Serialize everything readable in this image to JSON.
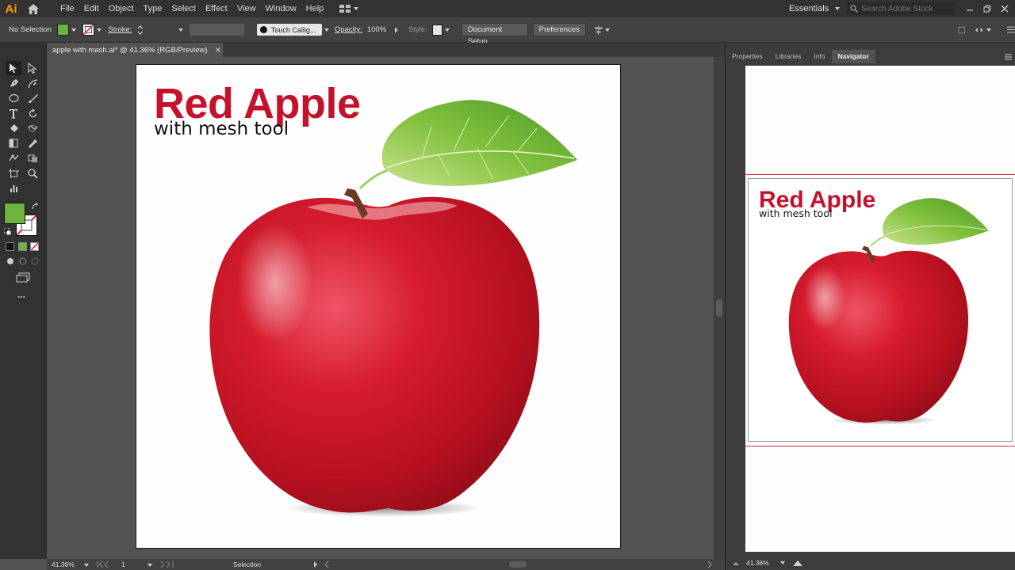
{
  "app": {
    "logo": "Ai"
  },
  "menu": [
    "File",
    "Edit",
    "Object",
    "Type",
    "Select",
    "Effect",
    "View",
    "Window",
    "Help"
  ],
  "workspace": {
    "label": "Essentials"
  },
  "search": {
    "placeholder": "Search Adobe Stock"
  },
  "control_bar": {
    "selection": "No Selection",
    "fill_color": "#6cb33f",
    "stroke_label": "Stroke:",
    "brush": "Touch Callig...",
    "opacity_label": "Opacity:",
    "opacity_value": "100%",
    "style_label": "Style:",
    "document_setup": "Document Setup",
    "preferences": "Preferences"
  },
  "document": {
    "tab_title": "apple with mash.ai* @ 41.36% (RGB/Preview)",
    "close": "×"
  },
  "artwork": {
    "title": "Red Apple",
    "subtitle": "with mesh tool",
    "title_color": "#c5122b"
  },
  "toolbar": {
    "fill_color": "#6cb33f",
    "more": "..."
  },
  "status": {
    "zoom": "41.36%",
    "artboard_number": "1",
    "tool": "Selection"
  },
  "panel": {
    "tabs": [
      "Properties",
      "Libraries",
      "Info",
      "Navigator"
    ],
    "active_tab": "Navigator",
    "zoom": "41.36%"
  },
  "icons": {
    "home": "home-icon",
    "arrange": "arrange-documents-icon",
    "search": "search-icon",
    "selection": "selection-tool-icon",
    "pen": "pen-tool-icon",
    "type": "type-tool-icon"
  }
}
